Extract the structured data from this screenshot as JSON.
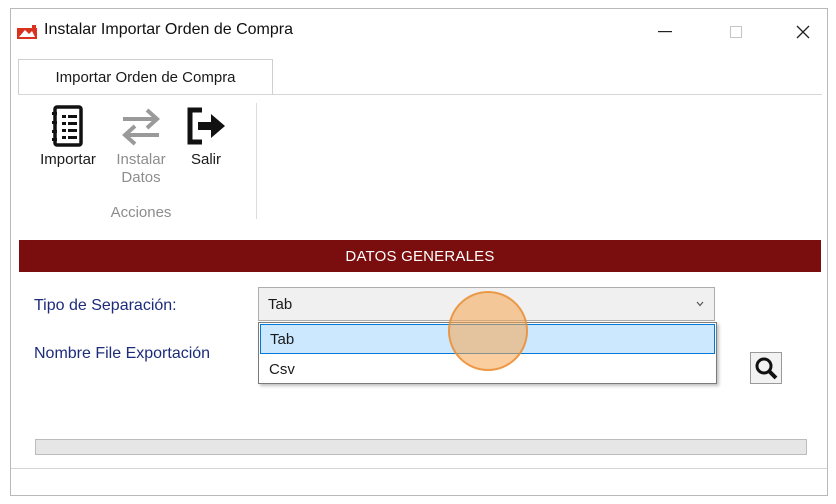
{
  "window": {
    "title": "Instalar Importar Orden de Compra"
  },
  "ribbon": {
    "tab_label": "Importar Orden de Compra",
    "buttons": {
      "import": {
        "label": "Importar",
        "icon": "notebook-icon"
      },
      "install": {
        "label_line1": "Instalar",
        "label_line2": "Datos",
        "icon": "swap-arrows-icon",
        "enabled": false
      },
      "exit": {
        "label": "Salir",
        "icon": "exit-icon"
      }
    },
    "group_label": "Acciones"
  },
  "section": {
    "header": "DATOS GENERALES"
  },
  "form": {
    "separation_label": "Tipo de Separación:",
    "separation_value": "Tab",
    "separation_options": [
      "Tab",
      "Csv"
    ],
    "export_file_label": "Nombre File Exportación",
    "search_icon": "search-icon"
  },
  "progress": {
    "value": 0
  },
  "colors": {
    "header_bar": "#7a0d0d",
    "label_text": "#1c2c7a",
    "selection_bg": "#cce8ff",
    "selection_border": "#0078d7"
  }
}
